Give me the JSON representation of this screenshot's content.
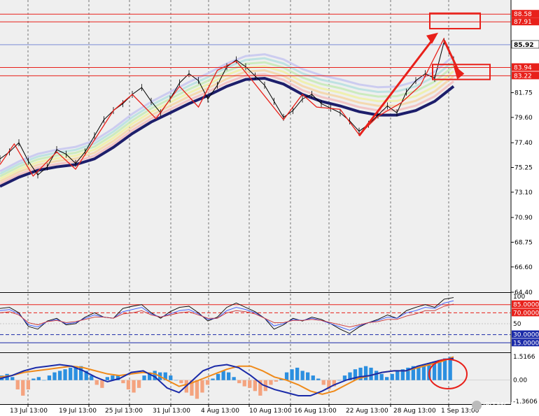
{
  "chart_data": {
    "type": "line",
    "price_panel": {
      "y_ticks": [
        "64.40",
        "66.60",
        "68.75",
        "70.90",
        "73.10",
        "75.25",
        "77.40",
        "79.60",
        "81.75"
      ],
      "ylim": [
        64.4,
        89.2
      ],
      "price_points": [
        [
          0,
          76.0
        ],
        [
          2,
          76.6
        ],
        [
          4,
          77.4
        ],
        [
          6,
          75.8
        ],
        [
          8,
          74.6
        ],
        [
          10,
          75.3
        ],
        [
          12,
          76.8
        ],
        [
          14,
          76.4
        ],
        [
          16,
          75.6
        ],
        [
          18,
          76.6
        ],
        [
          20,
          78.0
        ],
        [
          22,
          79.4
        ],
        [
          24,
          80.2
        ],
        [
          26,
          80.8
        ],
        [
          28,
          81.6
        ],
        [
          30,
          82.2
        ],
        [
          32,
          81.0
        ],
        [
          34,
          80.0
        ],
        [
          36,
          81.2
        ],
        [
          38,
          82.6
        ],
        [
          40,
          83.4
        ],
        [
          42,
          82.8
        ],
        [
          44,
          81.2
        ],
        [
          46,
          82.4
        ],
        [
          48,
          84.0
        ],
        [
          50,
          84.6
        ],
        [
          52,
          84.0
        ],
        [
          54,
          83.2
        ],
        [
          56,
          82.4
        ],
        [
          58,
          81.0
        ],
        [
          60,
          79.6
        ],
        [
          62,
          80.2
        ],
        [
          64,
          81.2
        ],
        [
          66,
          81.6
        ],
        [
          68,
          80.8
        ],
        [
          70,
          80.4
        ],
        [
          72,
          80.0
        ],
        [
          74,
          79.3
        ],
        [
          76,
          78.4
        ],
        [
          78,
          79.0
        ],
        [
          80,
          79.8
        ],
        [
          82,
          80.6
        ],
        [
          84,
          80.0
        ],
        [
          86,
          81.8
        ],
        [
          88,
          82.8
        ],
        [
          90,
          83.4
        ],
        [
          92,
          83.0
        ],
        [
          94,
          86.2
        ],
        [
          95,
          85.4
        ],
        [
          96,
          84.6
        ]
      ],
      "ma_points": [
        [
          0,
          73.6
        ],
        [
          4,
          74.4
        ],
        [
          8,
          75.0
        ],
        [
          12,
          75.3
        ],
        [
          16,
          75.5
        ],
        [
          20,
          76.0
        ],
        [
          24,
          77.0
        ],
        [
          28,
          78.2
        ],
        [
          32,
          79.2
        ],
        [
          36,
          80.0
        ],
        [
          40,
          80.8
        ],
        [
          44,
          81.5
        ],
        [
          48,
          82.3
        ],
        [
          52,
          82.9
        ],
        [
          56,
          83.0
        ],
        [
          60,
          82.5
        ],
        [
          64,
          81.6
        ],
        [
          68,
          81.0
        ],
        [
          72,
          80.6
        ],
        [
          76,
          80.1
        ],
        [
          80,
          79.8
        ],
        [
          84,
          79.8
        ],
        [
          88,
          80.2
        ],
        [
          92,
          81.0
        ],
        [
          96,
          82.3
        ]
      ],
      "zigzag": [
        [
          0,
          75.5
        ],
        [
          3,
          77.3
        ],
        [
          7,
          74.5
        ],
        [
          12,
          76.6
        ],
        [
          16,
          75.1
        ],
        [
          24,
          80.2
        ],
        [
          28,
          81.6
        ],
        [
          33,
          79.5
        ],
        [
          38,
          82.3
        ],
        [
          42,
          80.5
        ],
        [
          46,
          83.7
        ],
        [
          50,
          84.5
        ],
        [
          53,
          83.0
        ],
        [
          60,
          79.4
        ],
        [
          64,
          81.6
        ],
        [
          67,
          80.5
        ],
        [
          72,
          80.3
        ],
        [
          76,
          78.1
        ],
        [
          80,
          79.7
        ],
        [
          85,
          80.9
        ],
        [
          89,
          82.4
        ],
        [
          94,
          86.5
        ]
      ]
    },
    "price_labels": [
      {
        "text": "88.58",
        "y": 88.58,
        "style": "red"
      },
      {
        "text": "87.91",
        "y": 87.91,
        "style": "red"
      },
      {
        "text": "85.92",
        "y": 85.92,
        "style": "current"
      },
      {
        "text": "83.94",
        "y": 83.94,
        "style": "red"
      },
      {
        "text": "83.22",
        "y": 83.22,
        "style": "red"
      }
    ],
    "rsi_panel": {
      "levels": [
        {
          "text": "85.0000",
          "value": 85,
          "style": "red-solid"
        },
        {
          "text": "70.0000",
          "value": 70,
          "style": "red-dash"
        },
        {
          "text": "30.0000",
          "value": 30,
          "style": "blue-dash"
        },
        {
          "text": "15.0000",
          "value": 15,
          "style": "blue-solid"
        }
      ],
      "y_ticks": [
        "100",
        "50"
      ],
      "ylim": [
        0,
        100
      ],
      "series": [
        {
          "color": "#000000",
          "values": [
            78,
            80,
            70,
            45,
            40,
            55,
            60,
            48,
            50,
            62,
            70,
            62,
            60,
            78,
            82,
            85,
            70,
            60,
            72,
            80,
            82,
            70,
            55,
            62,
            80,
            88,
            80,
            72,
            60,
            40,
            48,
            60,
            55,
            62,
            58,
            50,
            40,
            32,
            44,
            52,
            58,
            66,
            60,
            74,
            80,
            85,
            80,
            95,
            98
          ]
        },
        {
          "color": "#3355ff",
          "values": [
            74,
            76,
            68,
            48,
            44,
            54,
            58,
            50,
            52,
            60,
            66,
            62,
            60,
            72,
            76,
            80,
            68,
            62,
            68,
            74,
            76,
            68,
            58,
            60,
            74,
            80,
            76,
            70,
            60,
            46,
            50,
            58,
            56,
            60,
            56,
            50,
            44,
            38,
            46,
            52,
            56,
            62,
            60,
            70,
            74,
            80,
            78,
            88,
            92
          ]
        },
        {
          "color": "#cc3333",
          "values": [
            70,
            72,
            66,
            52,
            48,
            54,
            56,
            52,
            54,
            58,
            62,
            62,
            60,
            68,
            70,
            74,
            66,
            62,
            66,
            70,
            72,
            66,
            60,
            60,
            70,
            74,
            72,
            68,
            60,
            52,
            52,
            56,
            56,
            58,
            56,
            52,
            48,
            44,
            48,
            52,
            54,
            58,
            58,
            64,
            68,
            74,
            74,
            82,
            86
          ]
        }
      ]
    },
    "macd_panel": {
      "y_ticks": [
        "1.5166",
        "0.00",
        "-1.3606"
      ],
      "ylim": [
        -1.3606,
        1.5166
      ],
      "hist": [
        0.3,
        0.4,
        0.2,
        -0.6,
        -1.0,
        -0.6,
        0.1,
        0.2,
        0.0,
        0.3,
        0.5,
        0.6,
        0.7,
        0.8,
        0.9,
        0.9,
        0.6,
        0.3,
        -0.3,
        -0.5,
        0.2,
        0.3,
        0.3,
        -0.2,
        -0.6,
        -0.8,
        -0.5,
        0.3,
        0.5,
        0.6,
        0.5,
        0.5,
        0.3,
        0.0,
        -0.2,
        -0.8,
        -1.0,
        -1.2,
        -0.8,
        -0.3,
        0.1,
        0.4,
        0.6,
        0.5,
        0.2,
        -0.2,
        -0.4,
        -0.5,
        -0.7,
        -1.0,
        -0.7,
        -0.3,
        -0.1,
        0.1,
        0.5,
        0.7,
        0.8,
        0.6,
        0.5,
        0.3,
        0.1,
        -0.3,
        -0.6,
        -0.4,
        0.0,
        0.3,
        0.5,
        0.7,
        0.8,
        0.9,
        0.8,
        0.6,
        0.4,
        0.2,
        0.4,
        0.6,
        0.7,
        0.8,
        0.9,
        0.9,
        1.0,
        1.1,
        1.2,
        1.3,
        1.4,
        1.5
      ],
      "signal": [
        0.2,
        0.3,
        0.5,
        0.6,
        0.7,
        0.8,
        0.9,
        0.8,
        0.6,
        0.4,
        0.3,
        0.4,
        0.5,
        0.4,
        0.0,
        -0.4,
        -0.2,
        0.1,
        0.4,
        0.7,
        0.9,
        0.9,
        0.6,
        0.2,
        0.0,
        -0.3,
        -0.7,
        -0.9,
        -0.7,
        -0.3,
        0.1,
        0.3,
        0.5,
        0.6,
        0.6,
        0.8,
        1.0,
        1.2,
        1.5
      ],
      "macd": [
        0.1,
        0.3,
        0.6,
        0.8,
        0.9,
        1.0,
        0.9,
        0.6,
        0.2,
        -0.1,
        0.1,
        0.5,
        0.6,
        0.2,
        -0.5,
        -0.8,
        -0.1,
        0.6,
        0.9,
        1.0,
        0.8,
        0.3,
        -0.3,
        -0.6,
        -0.8,
        -1.0,
        -1.0,
        -0.7,
        -0.3,
        0.0,
        0.2,
        0.3,
        0.5,
        0.6,
        0.6,
        0.9,
        1.1,
        1.3,
        1.4
      ]
    },
    "x_labels": [
      "13 Jul 13:00",
      "19 Jul 13:00",
      "25 Jul 13:00",
      "31 Jul 13:00",
      "4 Aug 13:00",
      "10 Aug 13:00",
      "16 Aug 13:00",
      "22 Aug 13:00",
      "28 Aug 13:00",
      "1 Sep 13:00"
    ],
    "grid": true
  },
  "watermark": "@TMGM",
  "colors": {
    "background": "#efefef",
    "red": "#e8201a",
    "ma": "#1d1e6b",
    "candle": "#000000",
    "blue_hist": "#2b8fe0",
    "orange_hist": "#f4a37f",
    "macd_line": "#1a2aa8",
    "signal_line": "#ef8a1a"
  }
}
